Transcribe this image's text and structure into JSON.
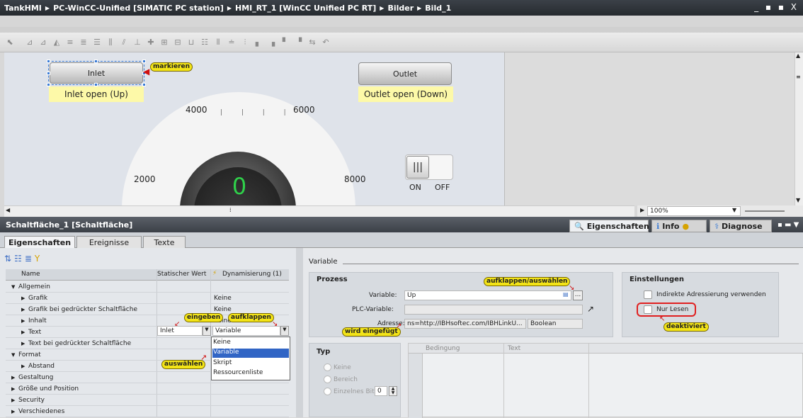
{
  "title": {
    "parts": [
      "TankHMI",
      "PC-WinCC-Unified [SIMATIC PC station]",
      "HMI_RT_1 [WinCC Unified PC RT]",
      "Bilder",
      "Bild_1"
    ],
    "controls": "_ ▪ ▪ X"
  },
  "canvas": {
    "inlet_button": "Inlet",
    "inlet_label": "Inlet open (Up)",
    "outlet_button": "Outlet",
    "outlet_label": "Outlet open (Down)",
    "gauge_ticks": [
      "2000",
      "4000",
      "6000",
      "8000"
    ],
    "gauge_value": "0",
    "switch_on": "ON",
    "switch_off": "OFF"
  },
  "zoom": "100%",
  "prop_title": "Schaltfläche_1 [Schaltfläche]",
  "panel_tabs": {
    "eigenschaften": "Eigenschaften",
    "info": "Info",
    "diagnose": "Diagnose"
  },
  "inner_tabs": [
    "Eigenschaften",
    "Ereignisse",
    "Texte"
  ],
  "table_headers": {
    "name": "Name",
    "static": "Statischer Wert",
    "dyn": "Dynamisierung (1)"
  },
  "tree": [
    {
      "label": "Allgemein",
      "level": 0,
      "arrow": "▼",
      "value": "",
      "dyn": ""
    },
    {
      "label": "Grafik",
      "level": 1,
      "arrow": "▶",
      "value": "",
      "dyn": "Keine"
    },
    {
      "label": "Grafik bei gedrückter Schaltfläche",
      "level": 1,
      "arrow": "▶",
      "value": "",
      "dyn": "Keine"
    },
    {
      "label": "Inhalt",
      "level": 1,
      "arrow": "▶",
      "value": "",
      "dyn": "Keine"
    },
    {
      "label": "Text",
      "level": 1,
      "arrow": "▶",
      "value": "Inlet",
      "dyn": "Variable"
    },
    {
      "label": "Text bei gedrückter Schaltfläche",
      "level": 1,
      "arrow": "▶",
      "value": "",
      "dyn": ""
    },
    {
      "label": "Format",
      "level": 0,
      "arrow": "▼",
      "value": "",
      "dyn": ""
    },
    {
      "label": "Abstand",
      "level": 1,
      "arrow": "▶",
      "value": "",
      "dyn": ""
    },
    {
      "label": "Gestaltung",
      "level": 0,
      "arrow": "▶",
      "value": "",
      "dyn": ""
    },
    {
      "label": "Größe und Position",
      "level": 0,
      "arrow": "▶",
      "value": "",
      "dyn": ""
    },
    {
      "label": "Security",
      "level": 0,
      "arrow": "▶",
      "value": "",
      "dyn": ""
    },
    {
      "label": "Verschiedenes",
      "level": 0,
      "arrow": "▶",
      "value": "",
      "dyn": ""
    }
  ],
  "dropdown_options": [
    "Keine",
    "Variable",
    "Skript",
    "Ressourcenliste"
  ],
  "dropdown_selected": "Variable",
  "annotations": {
    "markieren": "markieren",
    "eingeben": "eingeben",
    "aufklappen": "aufklappen",
    "auswaehlen": "auswählen",
    "aufklappen_auswaehlen": "aufklappen/auswählen",
    "wird_eingefuegt": "wird eingefügt",
    "deaktiviert": "deaktiviert"
  },
  "right": {
    "section": "Variable",
    "prozess": "Prozess",
    "variable_label": "Variable:",
    "variable_value": "Up",
    "plc_label": "PLC-Variable:",
    "adresse_label": "Adresse:",
    "adresse_value": "ns=http://IBHsoftec.com/IBHLinkU...",
    "datatype": "Boolean",
    "einstellungen": "Einstellungen",
    "indirekt": "Indirekte Adressierung verwenden",
    "nur_lesen": "Nur Lesen",
    "typ": "Typ",
    "typ_options": [
      "Keine",
      "Bereich",
      "Einzelnes Bit"
    ],
    "bit_value": "0",
    "grid_headers": [
      "Bedingung",
      "Text"
    ]
  },
  "colors": {
    "accent_annotation": "#f3e417",
    "selection": "#3165c5",
    "highlight_red": "#e02020"
  }
}
